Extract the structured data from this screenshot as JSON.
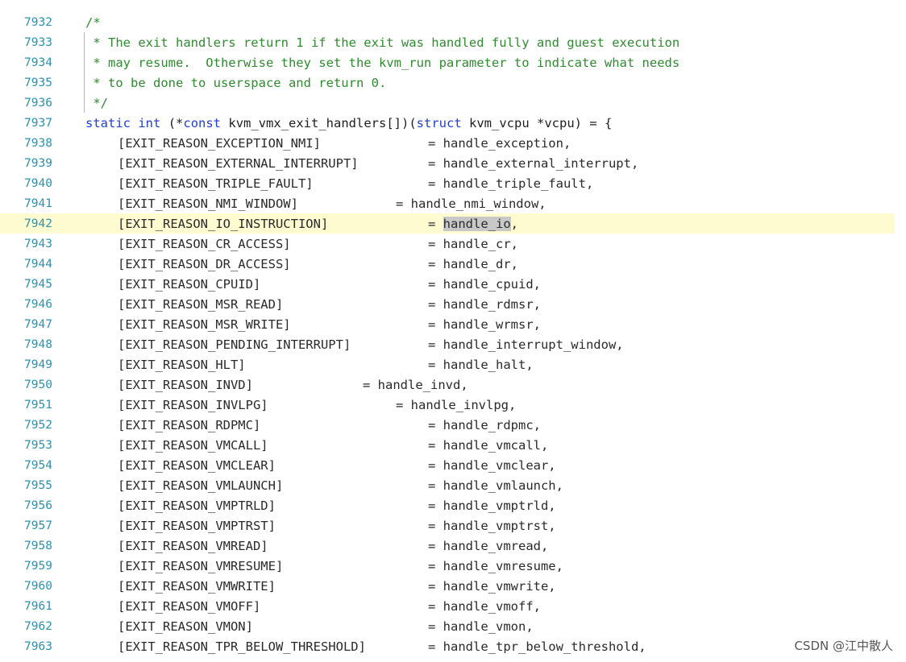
{
  "header_lines": [
    {
      "num": "7932",
      "text": "/*"
    },
    {
      "num": "7933",
      "text": " * The exit handlers return 1 if the exit was handled fully and guest execution"
    },
    {
      "num": "7934",
      "text": " * may resume.  Otherwise they set the kvm_run parameter to indicate what needs"
    },
    {
      "num": "7935",
      "text": " * to be done to userspace and return 0."
    },
    {
      "num": "7936",
      "text": " */"
    }
  ],
  "decl_line": {
    "num": "7937",
    "kw_static": "static",
    "kw_int": "int",
    "mid1": "(*",
    "kw_const": "const",
    "mid2": " kvm_vmx_exit_handlers[])(",
    "kw_struct": "struct",
    "tail": " kvm_vcpu *vcpu) = {"
  },
  "entries": [
    {
      "num": "7938",
      "key": "[EXIT_REASON_EXCEPTION_NMI]",
      "value": "= handle_exception,"
    },
    {
      "num": "7939",
      "key": "[EXIT_REASON_EXTERNAL_INTERRUPT]",
      "value": "= handle_external_interrupt,"
    },
    {
      "num": "7940",
      "key": "[EXIT_REASON_TRIPLE_FAULT]",
      "value": "= handle_triple_fault,"
    },
    {
      "num": "7941",
      "key": "[EXIT_REASON_NMI_WINDOW]",
      "value": "= handle_nmi_window,"
    },
    {
      "num": "7942",
      "key": "[EXIT_REASON_IO_INSTRUCTION]",
      "value_prefix": "= ",
      "value_selected": "handle_io",
      "value_suffix": ","
    },
    {
      "num": "7943",
      "key": "[EXIT_REASON_CR_ACCESS]",
      "value": "= handle_cr,"
    },
    {
      "num": "7944",
      "key": "[EXIT_REASON_DR_ACCESS]",
      "value": "= handle_dr,"
    },
    {
      "num": "7945",
      "key": "[EXIT_REASON_CPUID]",
      "value": "= handle_cpuid,"
    },
    {
      "num": "7946",
      "key": "[EXIT_REASON_MSR_READ]",
      "value": "= handle_rdmsr,"
    },
    {
      "num": "7947",
      "key": "[EXIT_REASON_MSR_WRITE]",
      "value": "= handle_wrmsr,"
    },
    {
      "num": "7948",
      "key": "[EXIT_REASON_PENDING_INTERRUPT]",
      "value": "= handle_interrupt_window,"
    },
    {
      "num": "7949",
      "key": "[EXIT_REASON_HLT]",
      "value": "= handle_halt,"
    },
    {
      "num": "7950",
      "key": "[EXIT_REASON_INVD]",
      "value": "= handle_invd,"
    },
    {
      "num": "7951",
      "key": "[EXIT_REASON_INVLPG]",
      "value": "= handle_invlpg,"
    },
    {
      "num": "7952",
      "key": "[EXIT_REASON_RDPMC]",
      "value": "= handle_rdpmc,"
    },
    {
      "num": "7953",
      "key": "[EXIT_REASON_VMCALL]",
      "value": "= handle_vmcall,"
    },
    {
      "num": "7954",
      "key": "[EXIT_REASON_VMCLEAR]",
      "value": "= handle_vmclear,"
    },
    {
      "num": "7955",
      "key": "[EXIT_REASON_VMLAUNCH]",
      "value": "= handle_vmlaunch,"
    },
    {
      "num": "7956",
      "key": "[EXIT_REASON_VMPTRLD]",
      "value": "= handle_vmptrld,"
    },
    {
      "num": "7957",
      "key": "[EXIT_REASON_VMPTRST]",
      "value": "= handle_vmptrst,"
    },
    {
      "num": "7958",
      "key": "[EXIT_REASON_VMREAD]",
      "value": "= handle_vmread,"
    },
    {
      "num": "7959",
      "key": "[EXIT_REASON_VMRESUME]",
      "value": "= handle_vmresume,"
    },
    {
      "num": "7960",
      "key": "[EXIT_REASON_VMWRITE]",
      "value": "= handle_vmwrite,"
    },
    {
      "num": "7961",
      "key": "[EXIT_REASON_VMOFF]",
      "value": "= handle_vmoff,"
    },
    {
      "num": "7962",
      "key": "[EXIT_REASON_VMON]",
      "value": "= handle_vmon,"
    },
    {
      "num": "7963",
      "key": "[EXIT_REASON_TPR_BELOW_THRESHOLD]",
      "value": "= handle_tpr_below_threshold,"
    }
  ],
  "watermark": "CSDN @江中散人",
  "colors": {
    "line_number": "#2b91af",
    "comment": "#2e8b2e",
    "keyword": "#1f3fd1",
    "current_line_highlight": "#fffbd0",
    "selection": "#c8c8c8"
  }
}
